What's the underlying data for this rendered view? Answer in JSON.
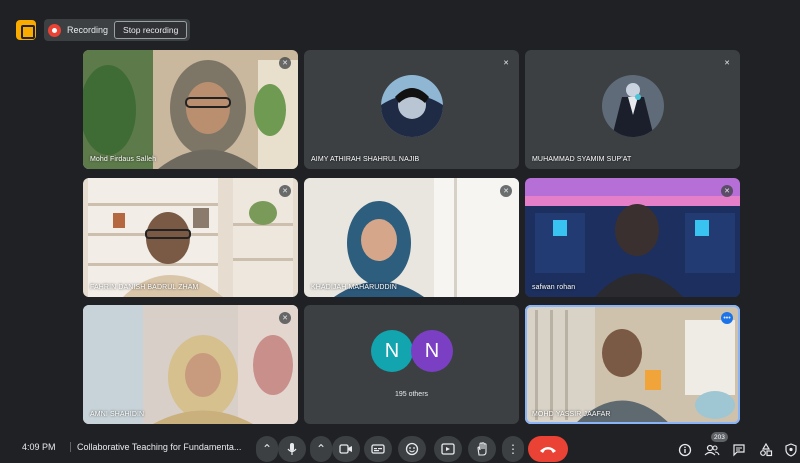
{
  "recording": {
    "label": "Recording",
    "stop_label": "Stop recording"
  },
  "participants": [
    {
      "name": "Mohd Firdaus Salleh"
    },
    {
      "name": "AIMY ATHIRAH SHAHRUL NAJIB"
    },
    {
      "name": "MUHAMMAD SYAMIM SUP'AT"
    },
    {
      "name": "FAHRIN DANISH BADRUL ZHAM"
    },
    {
      "name": "KHADIJAH MAHARUDDIN"
    },
    {
      "name": "safwan rohan"
    },
    {
      "name": "AMNI SHAHIDIN"
    },
    {
      "name": "195 others",
      "initials": [
        "N",
        "N"
      ]
    },
    {
      "name": "MOHD YASSIR JAAFAR"
    }
  ],
  "bottom_bar": {
    "time": "4:09 PM",
    "meeting_title": "Collaborative Teaching for Fundamenta...",
    "participant_count": "203"
  },
  "colors": {
    "background": "#202124",
    "tile": "#3c4043",
    "end_call": "#ea4335",
    "recording": "#ea4335",
    "avatar_teal": "#12a4af",
    "avatar_purple": "#7b3fc4"
  },
  "icons": [
    "meet-logo-icon",
    "record-icon",
    "mic-icon",
    "camera-icon",
    "captions-icon",
    "emoji-icon",
    "present-icon",
    "raise-hand-icon",
    "more-options-icon",
    "end-call-icon",
    "info-icon",
    "people-icon",
    "chat-icon",
    "activities-icon",
    "host-controls-icon"
  ]
}
